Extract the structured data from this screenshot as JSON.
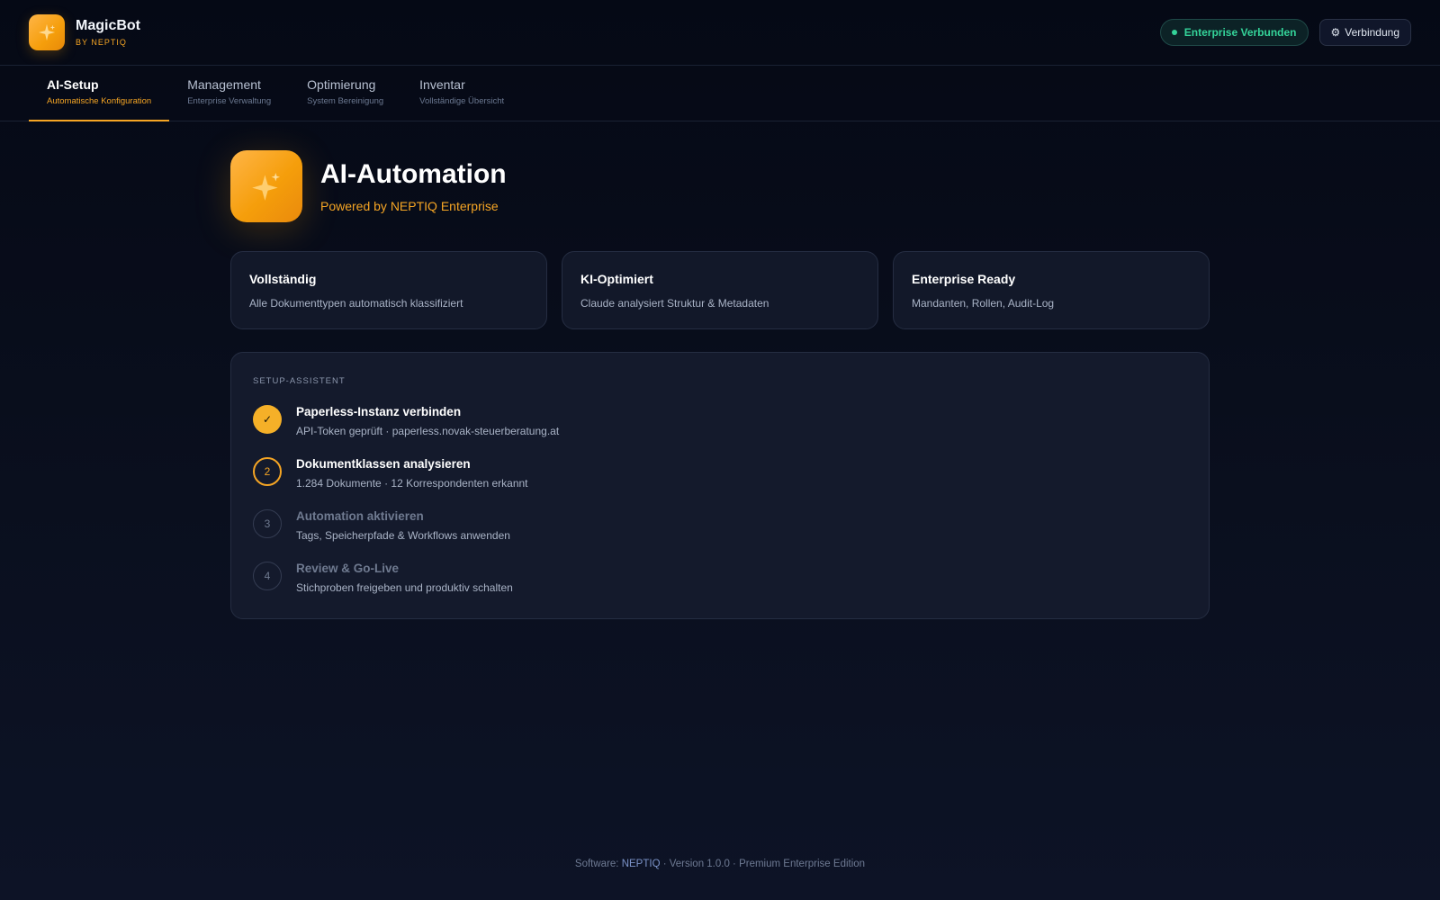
{
  "header": {
    "app_name": "MagicBot",
    "app_sub": "BY NEPTIQ",
    "logo_icon": "sparkle-icon",
    "status_label": "Enterprise Verbunden",
    "connection_label": "Verbindung",
    "connection_icon": "gear-icon"
  },
  "tabs": [
    {
      "label": "AI-Setup",
      "sub": "Automatische Konfiguration",
      "active": true
    },
    {
      "label": "Management",
      "sub": "Enterprise Verwaltung",
      "active": false
    },
    {
      "label": "Optimierung",
      "sub": "System Bereinigung",
      "active": false
    },
    {
      "label": "Inventar",
      "sub": "Vollständige Übersicht",
      "active": false
    }
  ],
  "hero": {
    "title": "AI-Automation",
    "subtitle": "Powered by NEPTIQ Enterprise",
    "icon": "sparkle-icon"
  },
  "features": [
    {
      "title": "Vollständig",
      "desc": "Alle Dokumenttypen automatisch klassifiziert"
    },
    {
      "title": "KI-Optimiert",
      "desc": "Claude analysiert Struktur & Metadaten"
    },
    {
      "title": "Enterprise Ready",
      "desc": "Mandanten, Rollen, Audit-Log"
    }
  ],
  "setup": {
    "heading": "SETUP-ASSISTENT",
    "steps": [
      {
        "marker": "✓",
        "state": "done",
        "title": "Paperless-Instanz verbinden",
        "desc": "API-Token geprüft · paperless.novak-steuerberatung.at"
      },
      {
        "marker": "2",
        "state": "current",
        "title": "Dokumentklassen analysieren",
        "desc": "1.284 Dokumente · 12 Korrespondenten erkannt"
      },
      {
        "marker": "3",
        "state": "pending",
        "title": "Automation aktivieren",
        "desc": "Tags, Speicherpfade & Workflows anwenden"
      },
      {
        "marker": "4",
        "state": "pending",
        "title": "Review & Go-Live",
        "desc": "Stichproben freigeben und produktiv schalten"
      }
    ]
  },
  "footer": {
    "prefix": "Software: ",
    "link": "NEPTIQ",
    "suffix": " · Version 1.0.0 · Premium Enterprise Edition"
  },
  "colors": {
    "accent": "#f5a524",
    "success": "#34d399",
    "background": "#0a0f1e"
  }
}
